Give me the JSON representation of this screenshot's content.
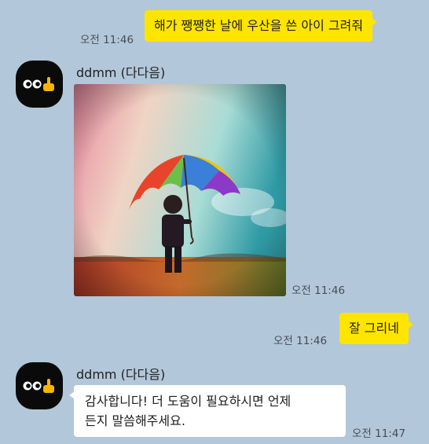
{
  "messages": {
    "first": {
      "text": "해가 쨍쨍한 날에 우산을 쓴 아이 그려줘",
      "time": "오전 11:46"
    },
    "bot_image": {
      "sender": "ddmm (다다음)",
      "time": "오전 11:46",
      "image_alt": "rainbow umbrella child"
    },
    "second": {
      "text": "잘 그리네",
      "time": "오전 11:46"
    },
    "bot_reply": {
      "sender": "ddmm (다다음)",
      "text": "감사합니다! 더 도움이 필요하시면 언제\n든지 말씀해주세요.",
      "time": "오전 11:47"
    }
  },
  "colors": {
    "background": "#b2c7d9",
    "my_bubble": "#fee500",
    "other_bubble": "#ffffff"
  },
  "icons": {
    "avatar": "eyes-pointing-hand-icon"
  }
}
